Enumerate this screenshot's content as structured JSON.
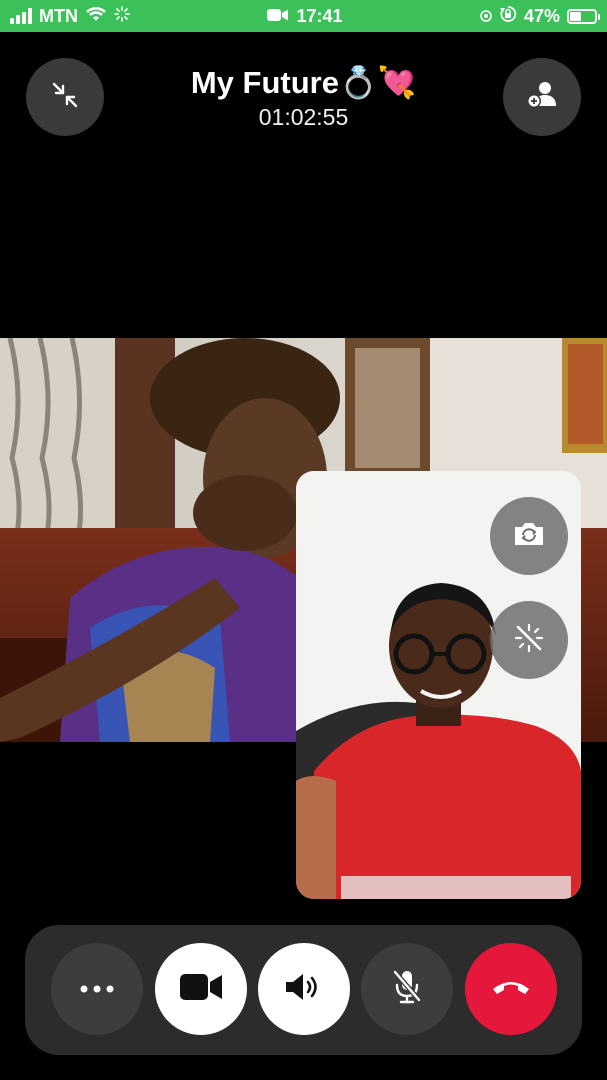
{
  "status_bar": {
    "carrier": "MTN",
    "time": "17:41",
    "battery": "47%",
    "battery_level": 0.47,
    "icons": [
      "signal-icon",
      "wifi-icon",
      "loading-icon",
      "video-camera-icon",
      "location-icon",
      "rotation-lock-icon",
      "battery-icon"
    ]
  },
  "call": {
    "name": "My Future💍💘",
    "timer": "01:02:55"
  },
  "header_buttons": {
    "minimize_icon": "minimize-arrows-icon",
    "add_participant_icon": "add-person-icon"
  },
  "self_view_buttons": {
    "flip_icon": "camera-flip-icon",
    "effects_icon": "magic-wand-off-icon"
  },
  "controls": [
    {
      "name": "more",
      "icon": "ellipsis-icon"
    },
    {
      "name": "video",
      "icon": "video-camera-icon",
      "active": true
    },
    {
      "name": "speaker",
      "icon": "speaker-icon",
      "active": true
    },
    {
      "name": "mute",
      "icon": "mic-off-icon",
      "active": false
    },
    {
      "name": "end-call",
      "icon": "phone-hangup-icon"
    }
  ],
  "colors": {
    "status_bar": "#3cc15a",
    "end_call": "#e5183b",
    "button_dark": "#3a3a3a",
    "button_active": "#ffffff"
  }
}
